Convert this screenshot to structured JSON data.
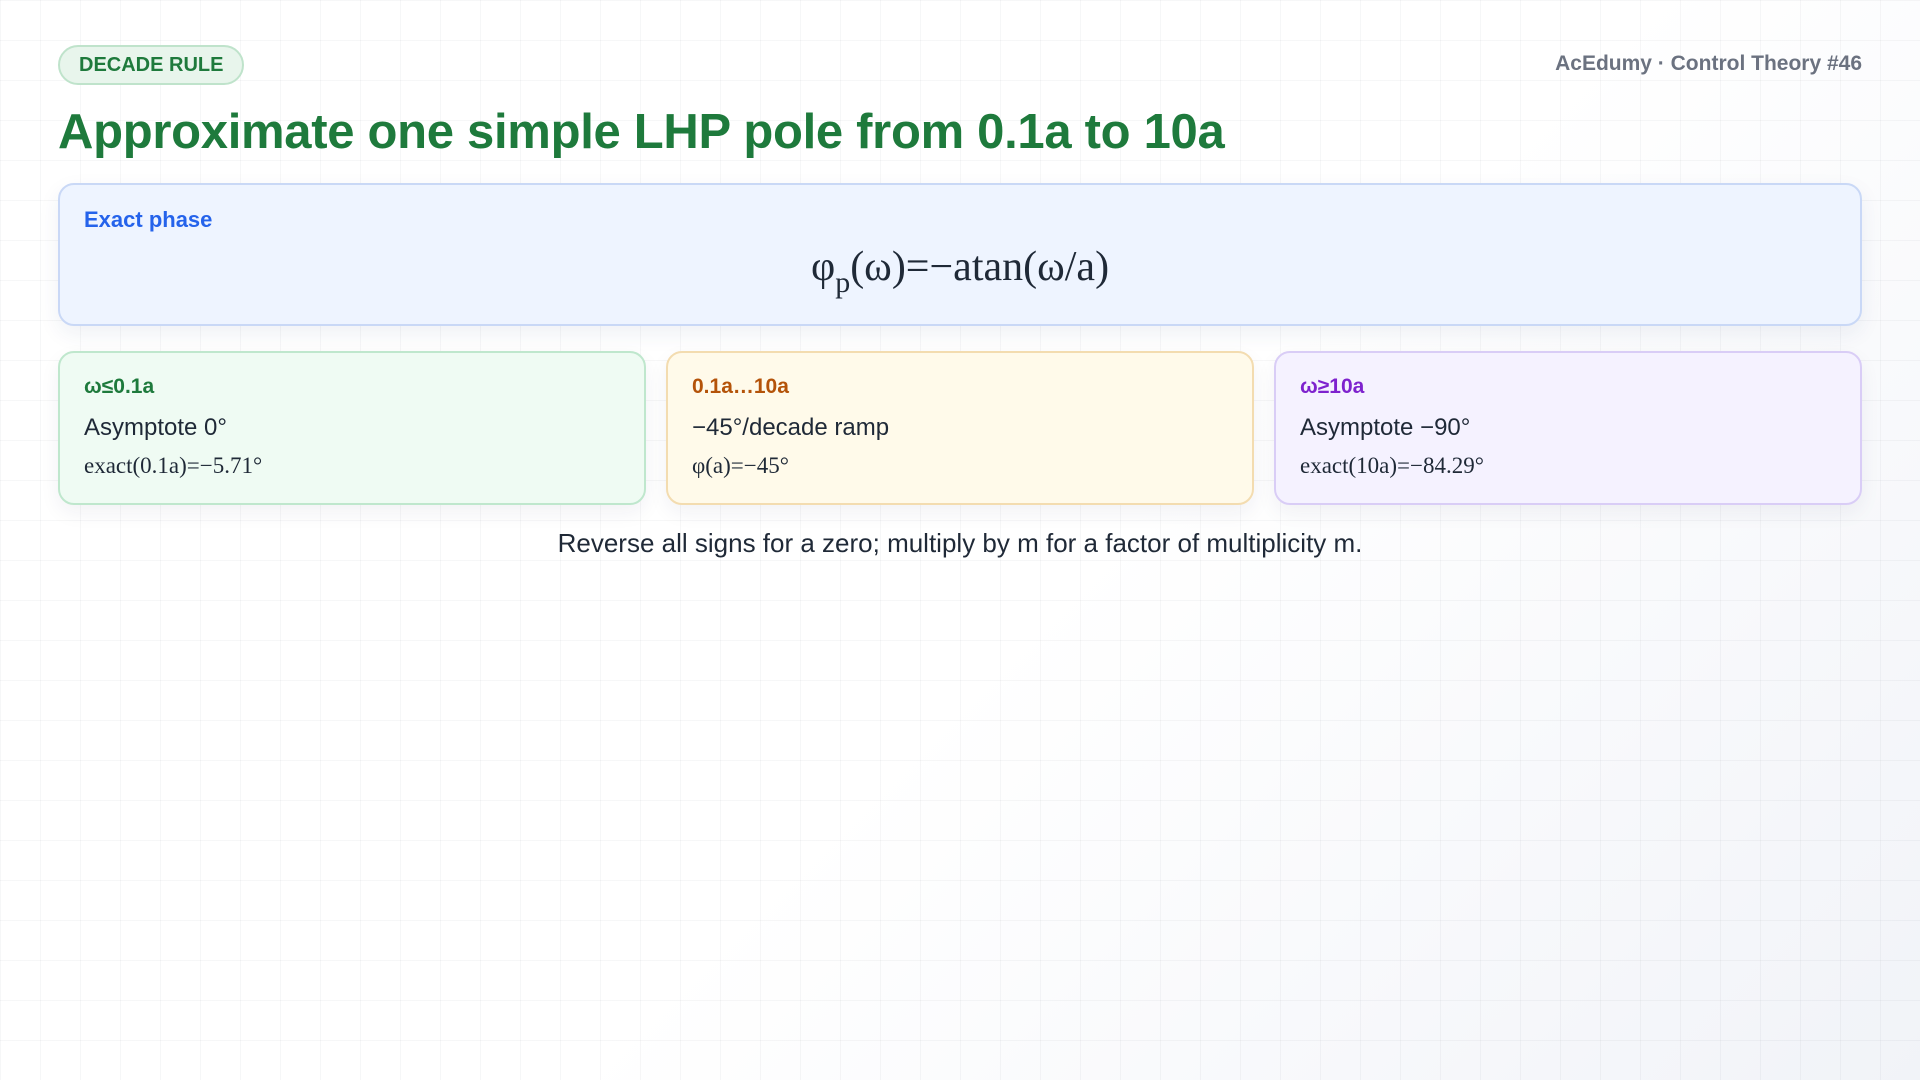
{
  "header": {
    "badge": "DECADE RULE",
    "brand": "AcEdumy · Control Theory #46",
    "title": "Approximate one simple LHP pole from 0.1a to 10a"
  },
  "exact_phase": {
    "label": "Exact phase",
    "formula_symbol": "φ",
    "formula_subscript": "p",
    "formula_rest": "(ω)=−atan(ω/a)"
  },
  "cards": [
    {
      "range": "ω≤0.1a",
      "description": "Asymptote 0°",
      "exact": "exact(0.1a)=−5.71°",
      "accent": "#1e7a3c"
    },
    {
      "range": "0.1a…10a",
      "description": "−45°/decade ramp",
      "exact": "φ(a)=−45°",
      "accent": "#b45309"
    },
    {
      "range": "ω≥10a",
      "description": "Asymptote −90°",
      "exact": "exact(10a)=−84.29°",
      "accent": "#7e22ce"
    }
  ],
  "note": "Reverse all signs for a zero; multiply by m for a factor of multiplicity m."
}
